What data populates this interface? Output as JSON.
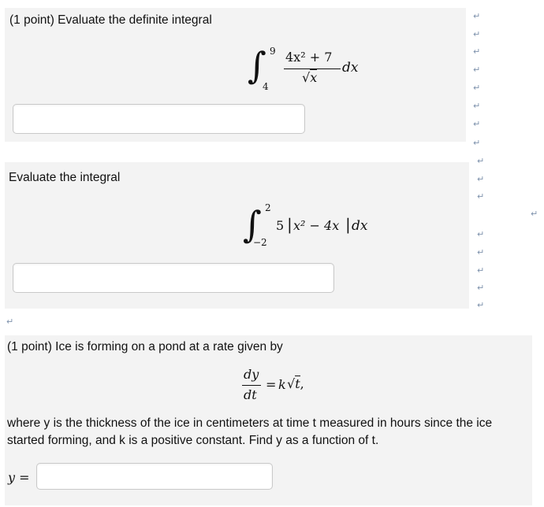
{
  "problem1": {
    "prompt": "(1 point) Evaluate the definite integral",
    "integral": {
      "upper": "9",
      "lower": "4",
      "numerator": "4x² + 7",
      "denominator_radicand": "x",
      "differential": "dx"
    }
  },
  "problem2": {
    "prompt": "Evaluate the integral",
    "integral": {
      "upper": "2",
      "lower": "−2",
      "coefficient": "5",
      "abs_content": "x² − 4x",
      "differential": "dx"
    }
  },
  "problem3": {
    "prompt": "(1 point) Ice is forming on a pond at a rate given by",
    "equation": {
      "num": "dy",
      "den": "dt",
      "rhs_k": "k",
      "rhs_t": "t",
      "tail": ","
    },
    "body_line1": "where y is the thickness of the ice in centimeters at time t measured in hours since the ice",
    "body_line2": "started forming, and k is a positive constant. Find y as a function of t.",
    "answer_label": "y ="
  },
  "icons": {
    "return_mark": "↵",
    "name": "return-arrow-icon"
  }
}
